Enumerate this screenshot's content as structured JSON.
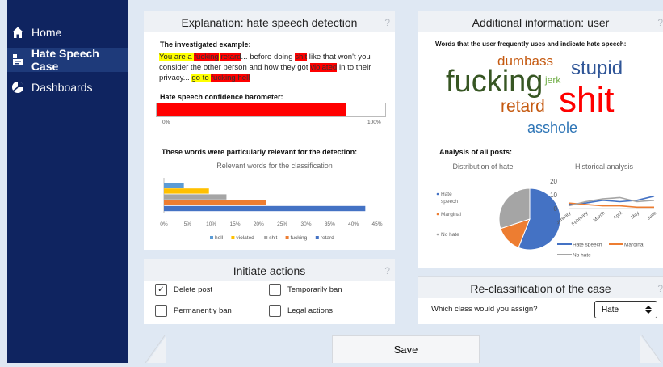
{
  "sidebar": {
    "items": [
      {
        "label": "Home",
        "icon": "home-icon"
      },
      {
        "label": "Hate Speech Case",
        "icon": "document-icon"
      },
      {
        "label": "Dashboards",
        "icon": "dashboard-icon"
      }
    ]
  },
  "explanation": {
    "title": "Explanation: hate speech detection",
    "help": "?",
    "example_label": "The investigated example:",
    "example_segments": [
      {
        "text": "You are a ",
        "hl": "y"
      },
      {
        "text": "fucking",
        "hl": "r"
      },
      {
        "text": " ",
        "hl": "y"
      },
      {
        "text": "retard",
        "hl": "r"
      },
      {
        "text": "... before doing ",
        "hl": ""
      },
      {
        "text": "shit",
        "hl": "r"
      },
      {
        "text": " like that won't you consider the other person and how they got ",
        "hl": ""
      },
      {
        "text": "violated",
        "hl": "r"
      },
      {
        "text": " in to their privacy... ",
        "hl": ""
      },
      {
        "text": "go to ",
        "hl": "y"
      },
      {
        "text": "fucking hell",
        "hl": "r"
      }
    ],
    "barometer_label": "Hate speech confidence barometer:",
    "barometer_value": 0.83,
    "barometer_min": "0%",
    "barometer_max": "100%",
    "words_label": "These words were particularly relevant for the detection:"
  },
  "chart_data": [
    {
      "type": "bar",
      "orientation": "horizontal",
      "title": "Relevant words for the classification",
      "categories": [
        "hell",
        "violated",
        "shit",
        "fucking",
        "retard"
      ],
      "values": [
        4.2,
        9.5,
        13.2,
        21.5,
        42.5
      ],
      "colors": [
        "#5b9bd5",
        "#ffc000",
        "#a5a5a5",
        "#ed7d31",
        "#4472c4"
      ],
      "xticks": [
        "0%",
        "5%",
        "10%",
        "15%",
        "20%",
        "25%",
        "30%",
        "35%",
        "40%",
        "45%"
      ],
      "xlim": [
        0,
        45
      ]
    },
    {
      "type": "pie",
      "title": "Distribution of hate",
      "categories": [
        "Hate speech",
        "Marginal",
        "No hate"
      ],
      "values": [
        56,
        14,
        30
      ],
      "colors": [
        "#4472c4",
        "#ed7d31",
        "#a5a5a5"
      ]
    },
    {
      "type": "line",
      "title": "Historical analysis",
      "x": [
        "January",
        "February",
        "March",
        "April",
        "May",
        "June"
      ],
      "series": [
        {
          "name": "Hate speech",
          "values": [
            3,
            4,
            6,
            5,
            6,
            9
          ],
          "color": "#4472c4"
        },
        {
          "name": "Marginal",
          "values": [
            4,
            3,
            2,
            2,
            1,
            1
          ],
          "color": "#ed7d31"
        },
        {
          "name": "No hate",
          "values": [
            2,
            5,
            7,
            8,
            5,
            6
          ],
          "color": "#a5a5a5"
        }
      ],
      "yticks": [
        "20",
        "10",
        "0"
      ],
      "ylim": [
        0,
        20
      ]
    }
  ],
  "additional": {
    "title": "Additional information: user",
    "help": "?",
    "words_caption": "Words that the user frequently uses and indicate hate speech:",
    "word_cloud": [
      {
        "word": "fucking",
        "color": "#375623"
      },
      {
        "word": "dumbass",
        "color": "#c55a11"
      },
      {
        "word": "stupid",
        "color": "#2f5597"
      },
      {
        "word": "jerk",
        "color": "#70ad47"
      },
      {
        "word": "shit",
        "color": "#ff0000"
      },
      {
        "word": "retard",
        "color": "#c55a11"
      },
      {
        "word": "asshole",
        "color": "#2e75b6"
      }
    ],
    "analysis_label": "Analysis of all posts:"
  },
  "actions": {
    "title": "Initiate actions",
    "help": "?",
    "options": [
      {
        "label": "Delete post",
        "checked": true
      },
      {
        "label": "Temporarily ban",
        "checked": false
      },
      {
        "label": "Permanently ban",
        "checked": false
      },
      {
        "label": "Legal actions",
        "checked": false
      }
    ]
  },
  "reclass": {
    "title": "Re-classification of the case",
    "help": "?",
    "question": "Which class would you assign?",
    "selected": "Hate"
  },
  "footer": {
    "save_label": "Save"
  }
}
